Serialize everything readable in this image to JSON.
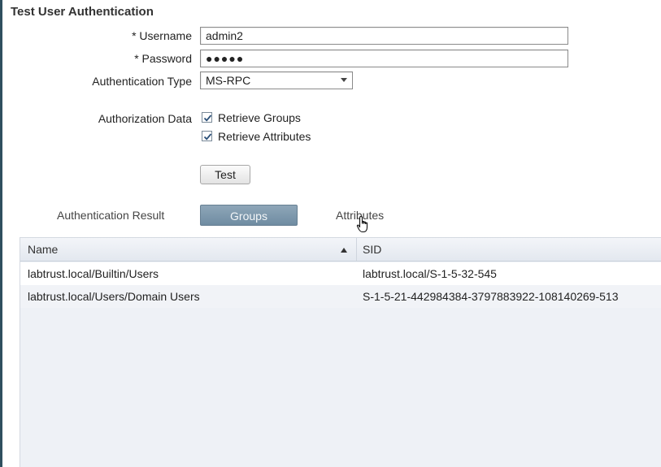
{
  "dialog": {
    "title": "Test User Authentication"
  },
  "form": {
    "username": {
      "required_mark": "*",
      "label": "Username",
      "value": "admin2"
    },
    "password": {
      "required_mark": "*",
      "label": "Password",
      "value": "●●●●●"
    },
    "auth_type": {
      "label": "Authentication Type",
      "value": "MS-RPC"
    },
    "authorization": {
      "label": "Authorization Data",
      "options": [
        {
          "label": "Retrieve Groups",
          "checked": true
        },
        {
          "label": "Retrieve Attributes",
          "checked": true
        }
      ]
    },
    "test_button": "Test"
  },
  "tabs": [
    {
      "label": "Authentication Result",
      "active": false
    },
    {
      "label": "Groups",
      "active": true
    },
    {
      "label": "Attributes",
      "active": false
    }
  ],
  "table": {
    "columns": [
      "Name",
      "SID"
    ],
    "sort": {
      "column": "Name",
      "direction": "ascending"
    },
    "rows": [
      [
        "labtrust.local/Builtin/Users",
        "labtrust.local/S-1-5-32-545"
      ],
      [
        "labtrust.local/Users/Domain Users",
        "S-1-5-21-442984384-3797883922-108140269-513"
      ]
    ]
  },
  "colors": {
    "accent_tab": "#7e98ab",
    "checkmark": "#2a4f78",
    "grid_bg": "#eef1f6"
  },
  "icons": {
    "sort": "sort-ascending-icon",
    "cursor": "hand-pointer-icon",
    "dropdown": "chevron-down-icon",
    "check": "checkmark-icon"
  }
}
